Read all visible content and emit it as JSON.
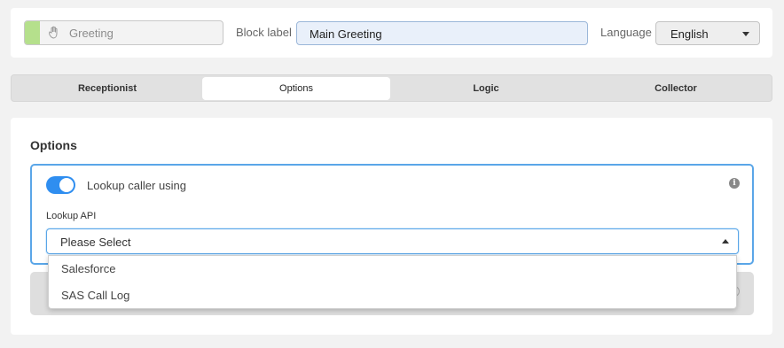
{
  "header": {
    "block_type": "Greeting",
    "block_label_caption": "Block label",
    "block_label_value": "Main Greeting",
    "language_caption": "Language",
    "language_value": "English"
  },
  "tabs": [
    {
      "label": "Receptionist",
      "active": false
    },
    {
      "label": "Options",
      "active": true
    },
    {
      "label": "Logic",
      "active": false
    },
    {
      "label": "Collector",
      "active": false
    }
  ],
  "options": {
    "section_title": "Options",
    "toggle_label": "Lookup caller using",
    "toggle_on": true,
    "lookup_api_label": "Lookup API",
    "select_value": "Please Select",
    "dropdown_items": [
      "Salesforce",
      "SAS Call Log"
    ]
  },
  "colors": {
    "accent_green": "#b5e08c",
    "focus_blue": "#5aa6e8",
    "toggle_blue": "#2f8ef0"
  },
  "icons": {
    "block_type_icon": "hand-icon",
    "info_icon": "info-icon",
    "language_caret": "caret-down-icon",
    "select_caret": "caret-up-icon"
  }
}
